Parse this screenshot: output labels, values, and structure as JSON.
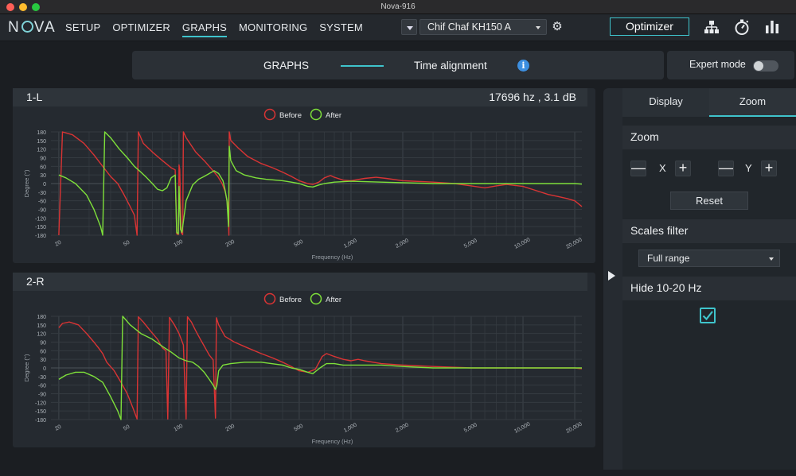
{
  "window": {
    "title": "Nova-916"
  },
  "nav": {
    "logo": "NOVA",
    "items": [
      {
        "label": "SETUP",
        "active": false
      },
      {
        "label": "OPTIMIZER",
        "active": false
      },
      {
        "label": "GRAPHS",
        "active": true
      },
      {
        "label": "MONITORING",
        "active": false
      },
      {
        "label": "SYSTEM",
        "active": false
      }
    ],
    "preset": "Chif Chaf KH150 A",
    "optimizer_button": "Optimizer",
    "icons": [
      "gear-icon",
      "network-icon",
      "stopwatch-icon",
      "bar-chart-icon"
    ]
  },
  "subheader": {
    "graphs_label": "GRAPHS",
    "time_alignment_label": "Time alignment",
    "info_glyph": "i",
    "expert_mode_label": "Expert mode",
    "expert_mode_on": false
  },
  "panels": [
    {
      "title": "1-L",
      "readout": "17696 hz , 3.1 dB"
    },
    {
      "title": "2-R",
      "readout": ""
    }
  ],
  "side": {
    "tabs": [
      {
        "label": "Display",
        "active": false
      },
      {
        "label": "Zoom",
        "active": true
      }
    ],
    "zoom_title": "Zoom",
    "zoom_x_label": "X",
    "zoom_y_label": "Y",
    "minus_glyph": "—",
    "plus_glyph": "+",
    "reset_label": "Reset",
    "scales_title": "Scales filter",
    "scales_value": "Full range",
    "hide_title": "Hide 10-20 Hz",
    "hide_checked": true
  },
  "colors": {
    "accent": "#3fc4cc",
    "before": "#d93434",
    "after": "#7ee03a",
    "info": "#3d8fe0"
  },
  "chart_data": [
    {
      "type": "line",
      "panel": "1-L",
      "xlabel": "Frequency (Hz)",
      "ylabel": "Degree (°)",
      "xscale": "log",
      "xlim": [
        18,
        22000
      ],
      "ylim": [
        -180,
        180
      ],
      "x_ticks": [
        20,
        50,
        100,
        200,
        500,
        1000,
        2000,
        5000,
        10000,
        20000
      ],
      "x_tick_labels": [
        "20",
        "50",
        "100",
        "200",
        "500",
        "1,000",
        "2,000",
        "5,000",
        "10,000",
        "20,000"
      ],
      "y_ticks": [
        180,
        150,
        120,
        90,
        60,
        30,
        0,
        -30,
        -60,
        -90,
        -120,
        -150,
        -180
      ],
      "grid": true,
      "legend": "top-center",
      "series": [
        {
          "name": "Before",
          "color": "#d93434",
          "points": [
            [
              20,
              -180
            ],
            [
              21,
              180
            ],
            [
              24,
              170
            ],
            [
              28,
              140
            ],
            [
              32,
              100
            ],
            [
              36,
              60
            ],
            [
              40,
              25
            ],
            [
              44,
              0
            ],
            [
              48,
              -40
            ],
            [
              52,
              -80
            ],
            [
              55,
              -110
            ],
            [
              57,
              -180
            ],
            [
              58,
              180
            ],
            [
              62,
              140
            ],
            [
              70,
              110
            ],
            [
              80,
              80
            ],
            [
              90,
              55
            ],
            [
              95,
              48
            ],
            [
              97,
              -175
            ],
            [
              99,
              -178
            ],
            [
              100,
              65
            ],
            [
              101,
              50
            ],
            [
              103,
              -172
            ],
            [
              105,
              -178
            ],
            [
              106,
              180
            ],
            [
              110,
              160
            ],
            [
              125,
              110
            ],
            [
              140,
              80
            ],
            [
              155,
              50
            ],
            [
              168,
              25
            ],
            [
              178,
              0
            ],
            [
              186,
              -30
            ],
            [
              192,
              -70
            ],
            [
              195,
              -180
            ],
            [
              196,
              180
            ],
            [
              200,
              150
            ],
            [
              220,
              125
            ],
            [
              250,
              95
            ],
            [
              300,
              70
            ],
            [
              350,
              55
            ],
            [
              400,
              40
            ],
            [
              450,
              25
            ],
            [
              500,
              10
            ],
            [
              560,
              0
            ],
            [
              600,
              -3
            ],
            [
              650,
              5
            ],
            [
              700,
              20
            ],
            [
              760,
              28
            ],
            [
              800,
              22
            ],
            [
              900,
              12
            ],
            [
              1000,
              10
            ],
            [
              1200,
              18
            ],
            [
              1400,
              22
            ],
            [
              1600,
              18
            ],
            [
              2000,
              10
            ],
            [
              3000,
              5
            ],
            [
              4000,
              0
            ],
            [
              5000,
              -8
            ],
            [
              6000,
              -15
            ],
            [
              7000,
              -8
            ],
            [
              8000,
              -3
            ],
            [
              10000,
              -10
            ],
            [
              12000,
              -25
            ],
            [
              14000,
              -38
            ],
            [
              16000,
              -45
            ],
            [
              18000,
              -52
            ],
            [
              20000,
              -60
            ],
            [
              22000,
              -80
            ]
          ]
        },
        {
          "name": "After",
          "color": "#7ee03a",
          "points": [
            [
              20,
              30
            ],
            [
              22,
              20
            ],
            [
              25,
              0
            ],
            [
              29,
              -40
            ],
            [
              32,
              -90
            ],
            [
              35,
              -150
            ],
            [
              36,
              -180
            ],
            [
              37,
              180
            ],
            [
              40,
              160
            ],
            [
              45,
              120
            ],
            [
              50,
              90
            ],
            [
              55,
              60
            ],
            [
              60,
              40
            ],
            [
              65,
              20
            ],
            [
              70,
              0
            ],
            [
              75,
              -20
            ],
            [
              80,
              -25
            ],
            [
              85,
              -15
            ],
            [
              90,
              20
            ],
            [
              95,
              30
            ],
            [
              97,
              -170
            ],
            [
              99,
              -175
            ],
            [
              100,
              -10
            ],
            [
              102,
              -160
            ],
            [
              104,
              -170
            ],
            [
              110,
              -60
            ],
            [
              120,
              -5
            ],
            [
              130,
              15
            ],
            [
              140,
              25
            ],
            [
              150,
              35
            ],
            [
              160,
              45
            ],
            [
              170,
              35
            ],
            [
              180,
              10
            ],
            [
              185,
              -20
            ],
            [
              190,
              -60
            ],
            [
              194,
              -150
            ],
            [
              196,
              130
            ],
            [
              200,
              80
            ],
            [
              215,
              45
            ],
            [
              240,
              30
            ],
            [
              280,
              20
            ],
            [
              320,
              15
            ],
            [
              400,
              10
            ],
            [
              450,
              5
            ],
            [
              500,
              0
            ],
            [
              560,
              -10
            ],
            [
              600,
              -12
            ],
            [
              650,
              -5
            ],
            [
              700,
              0
            ],
            [
              800,
              5
            ],
            [
              1000,
              8
            ],
            [
              1500,
              5
            ],
            [
              2000,
              3
            ],
            [
              3000,
              0
            ],
            [
              5000,
              0
            ],
            [
              8000,
              0
            ],
            [
              12000,
              0
            ],
            [
              16000,
              0
            ],
            [
              20000,
              0
            ],
            [
              22000,
              -2
            ]
          ]
        }
      ]
    },
    {
      "type": "line",
      "panel": "2-R",
      "xlabel": "Frequency (Hz)",
      "ylabel": "Degree (°)",
      "xscale": "log",
      "xlim": [
        18,
        22000
      ],
      "ylim": [
        -180,
        180
      ],
      "x_ticks": [
        20,
        50,
        100,
        200,
        500,
        1000,
        2000,
        5000,
        10000,
        20000
      ],
      "x_tick_labels": [
        "20",
        "50",
        "100",
        "200",
        "500",
        "1,000",
        "2,000",
        "5,000",
        "10,000",
        "20,000"
      ],
      "y_ticks": [
        180,
        150,
        120,
        90,
        60,
        30,
        0,
        -30,
        -60,
        -90,
        -120,
        -150,
        -180
      ],
      "grid": true,
      "legend": "top-center",
      "series": [
        {
          "name": "Before",
          "color": "#d93434",
          "points": [
            [
              20,
              140
            ],
            [
              21,
              155
            ],
            [
              23,
              160
            ],
            [
              26,
              150
            ],
            [
              29,
              120
            ],
            [
              32,
              90
            ],
            [
              34,
              70
            ],
            [
              36,
              50
            ],
            [
              38,
              20
            ],
            [
              42,
              -10
            ],
            [
              46,
              -50
            ],
            [
              50,
              -90
            ],
            [
              54,
              -140
            ],
            [
              57,
              -178
            ],
            [
              58,
              178
            ],
            [
              62,
              160
            ],
            [
              68,
              130
            ],
            [
              75,
              100
            ],
            [
              80,
              70
            ],
            [
              84,
              60
            ],
            [
              86,
              -178
            ],
            [
              88,
              176
            ],
            [
              94,
              150
            ],
            [
              100,
              120
            ],
            [
              106,
              80
            ],
            [
              110,
              -178
            ],
            [
              112,
              178
            ],
            [
              118,
              160
            ],
            [
              125,
              130
            ],
            [
              133,
              100
            ],
            [
              142,
              70
            ],
            [
              150,
              45
            ],
            [
              158,
              28
            ],
            [
              163,
              -175
            ],
            [
              165,
              175
            ],
            [
              170,
              150
            ],
            [
              185,
              110
            ],
            [
              210,
              90
            ],
            [
              250,
              70
            ],
            [
              300,
              50
            ],
            [
              350,
              35
            ],
            [
              400,
              20
            ],
            [
              450,
              5
            ],
            [
              500,
              -10
            ],
            [
              560,
              -15
            ],
            [
              620,
              -5
            ],
            [
              680,
              40
            ],
            [
              720,
              50
            ],
            [
              800,
              40
            ],
            [
              900,
              30
            ],
            [
              1000,
              25
            ],
            [
              1100,
              30
            ],
            [
              1200,
              25
            ],
            [
              1500,
              15
            ],
            [
              2000,
              10
            ],
            [
              3000,
              5
            ],
            [
              5000,
              0
            ],
            [
              8000,
              0
            ],
            [
              12000,
              0
            ],
            [
              16000,
              0
            ],
            [
              20000,
              0
            ],
            [
              22000,
              -3
            ]
          ]
        },
        {
          "name": "After",
          "color": "#7ee03a",
          "points": [
            [
              20,
              -40
            ],
            [
              22,
              -25
            ],
            [
              25,
              -15
            ],
            [
              28,
              -15
            ],
            [
              32,
              -30
            ],
            [
              36,
              -50
            ],
            [
              40,
              -100
            ],
            [
              44,
              -150
            ],
            [
              46,
              -180
            ],
            [
              47,
              180
            ],
            [
              52,
              150
            ],
            [
              60,
              120
            ],
            [
              70,
              100
            ],
            [
              80,
              75
            ],
            [
              90,
              55
            ],
            [
              100,
              35
            ],
            [
              110,
              25
            ],
            [
              120,
              20
            ],
            [
              130,
              5
            ],
            [
              140,
              -15
            ],
            [
              150,
              -40
            ],
            [
              158,
              -60
            ],
            [
              163,
              -75
            ],
            [
              166,
              -60
            ],
            [
              170,
              -10
            ],
            [
              180,
              10
            ],
            [
              200,
              15
            ],
            [
              240,
              20
            ],
            [
              300,
              20
            ],
            [
              400,
              10
            ],
            [
              450,
              0
            ],
            [
              500,
              -5
            ],
            [
              560,
              -15
            ],
            [
              600,
              -20
            ],
            [
              660,
              0
            ],
            [
              720,
              15
            ],
            [
              800,
              15
            ],
            [
              900,
              10
            ],
            [
              1000,
              10
            ],
            [
              1500,
              10
            ],
            [
              2000,
              5
            ],
            [
              3000,
              0
            ],
            [
              5000,
              0
            ],
            [
              8000,
              0
            ],
            [
              12000,
              0
            ],
            [
              16000,
              0
            ],
            [
              20000,
              0
            ],
            [
              22000,
              0
            ]
          ]
        }
      ]
    }
  ]
}
